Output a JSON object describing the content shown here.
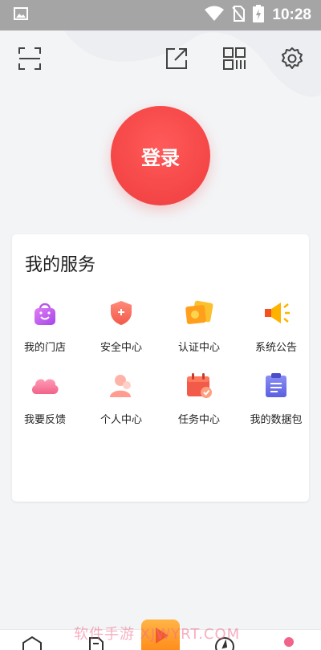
{
  "status_bar": {
    "time": "10:28",
    "icons": [
      "image-icon",
      "wifi-icon",
      "no-sim-icon",
      "battery-charging-icon"
    ]
  },
  "toolbar": {
    "icons": [
      "scan-icon",
      "share-icon",
      "qr-code-icon",
      "settings-icon"
    ]
  },
  "login": {
    "label": "登录"
  },
  "services": {
    "title": "我的服务",
    "items": [
      {
        "label": "我的门店",
        "icon": "store-bag-icon"
      },
      {
        "label": "安全中心",
        "icon": "shield-icon"
      },
      {
        "label": "认证中心",
        "icon": "certificate-icon"
      },
      {
        "label": "系统公告",
        "icon": "megaphone-icon"
      },
      {
        "label": "我要反馈",
        "icon": "feedback-cloud-icon"
      },
      {
        "label": "个人中心",
        "icon": "user-icon"
      },
      {
        "label": "任务中心",
        "icon": "calendar-check-icon"
      },
      {
        "label": "我的数据包",
        "icon": "clipboard-icon"
      }
    ]
  },
  "bottom_nav": {
    "icons": [
      "home-icon",
      "document-icon",
      "play-icon",
      "compass-icon",
      "profile-icon"
    ],
    "watermark": "软件手游  XJWYRT.COM"
  },
  "colors": {
    "accent": "#f64848",
    "status_bar": "#a5a5a5",
    "background": "#f3f4f6"
  }
}
